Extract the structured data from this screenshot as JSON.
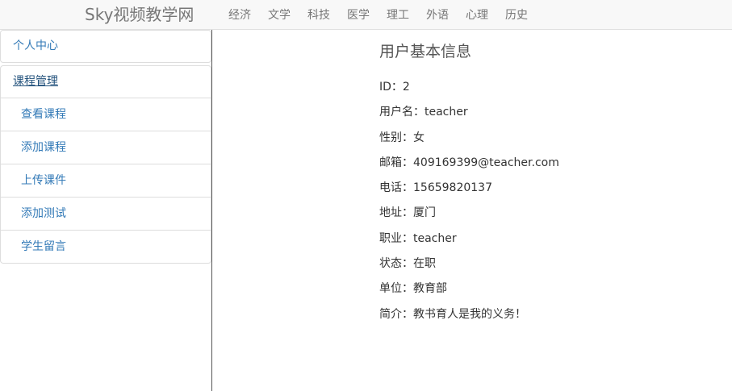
{
  "navbar": {
    "brand_sky": "Sky",
    "brand_rest": "视频教学网",
    "links": [
      "经济",
      "文学",
      "科技",
      "医学",
      "理工",
      "外语",
      "心理",
      "历史"
    ]
  },
  "sidebar": {
    "personal_center": "个人中心",
    "course_management": "课程管理",
    "items": [
      "查看课程",
      "添加课程",
      "上传课件",
      "添加测试",
      "学生留言"
    ]
  },
  "main": {
    "title": "用户基本信息",
    "fields": [
      {
        "label": "ID：",
        "value": "2"
      },
      {
        "label": "用户名：",
        "value": "teacher"
      },
      {
        "label": "性别：",
        "value": "女"
      },
      {
        "label": "邮箱：",
        "value": "409169399@teacher.com"
      },
      {
        "label": "电话：",
        "value": "15659820137"
      },
      {
        "label": "地址：",
        "value": "厦门"
      },
      {
        "label": "职业：",
        "value": "teacher"
      },
      {
        "label": "状态：",
        "value": "在职"
      },
      {
        "label": "单位：",
        "value": "教育部"
      },
      {
        "label": "简介：",
        "value": "教书育人是我的义务！"
      }
    ]
  },
  "colors": {
    "link": "#337ab7",
    "navbar_bg": "#f8f8f8",
    "nav_text": "#777777"
  }
}
